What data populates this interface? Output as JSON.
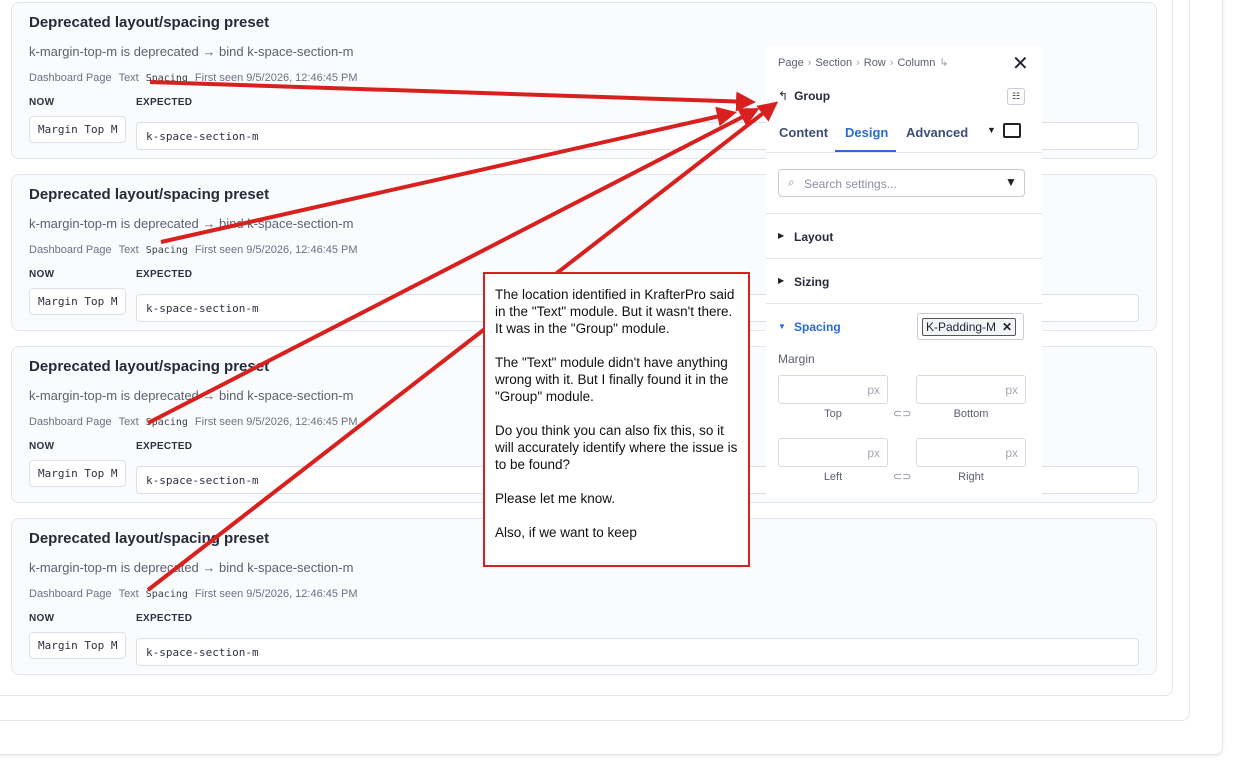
{
  "issues": [
    {
      "title": "Deprecated layout/spacing preset",
      "desc": "k-margin-top-m is deprecated → bind k-space-section-m",
      "page": "Dashboard Page",
      "module": "Text",
      "group": "Spacing",
      "first_seen": "First seen 9/5/2026, 12:46:45 PM",
      "now_label": "NOW",
      "expected_label": "EXPECTED",
      "now_value": "Margin Top M",
      "expected_value": "k-space-section-m"
    },
    {
      "title": "Deprecated layout/spacing preset",
      "desc": "k-margin-top-m is deprecated → bind k-space-section-m",
      "page": "Dashboard Page",
      "module": "Text",
      "group": "Spacing",
      "first_seen": "First seen 9/5/2026, 12:46:45 PM",
      "now_label": "NOW",
      "expected_label": "EXPECTED",
      "now_value": "Margin Top M",
      "expected_value": "k-space-section-m"
    },
    {
      "title": "Deprecated layout/spacing preset",
      "desc": "k-margin-top-m is deprecated → bind k-space-section-m",
      "page": "Dashboard Page",
      "module": "Text",
      "group": "Spacing",
      "first_seen": "First seen 9/5/2026, 12:46:45 PM",
      "now_label": "NOW",
      "expected_label": "EXPECTED",
      "now_value": "Margin Top M",
      "expected_value": "k-space-section-m"
    },
    {
      "title": "Deprecated layout/spacing preset",
      "desc": "k-margin-top-m is deprecated → bind k-space-section-m",
      "page": "Dashboard Page",
      "module": "Text",
      "group": "Spacing",
      "first_seen": "First seen 9/5/2026, 12:46:45 PM",
      "now_label": "NOW",
      "expected_label": "EXPECTED",
      "now_value": "Margin Top M",
      "expected_value": "k-space-section-m"
    }
  ],
  "panel": {
    "breadcrumb": [
      "Page",
      "Section",
      "Row",
      "Column"
    ],
    "breadcrumb_tail_icon": "return-arrow-icon",
    "element_name": "Group",
    "tabs": [
      "Content",
      "Design",
      "Advanced"
    ],
    "active_tab": "Design",
    "search_placeholder": "Search settings...",
    "sections": [
      "Layout",
      "Sizing",
      "Spacing"
    ],
    "spacing_chip": "K-Padding-M",
    "margin_label": "Margin",
    "unit": "px",
    "fields": [
      "Top",
      "Bottom",
      "Left",
      "Right"
    ]
  },
  "annotation": {
    "paragraphs": [
      "The location identified in KrafterPro said in the \"Text\" module. But it wasn't there. It was in the \"Group\" module.",
      "The \"Text\" module didn't have anything wrong with it. But I finally found it in the \"Group\" module.",
      "Do you think you can also fix this, so it will accurately identify where the issue is to be found?",
      "Please let me know.",
      "Also, if we want to keep"
    ],
    "arrow_color": "#d8201e"
  },
  "colors": {
    "accent": "#2a6ad6",
    "annotation_red": "#d8201e"
  }
}
